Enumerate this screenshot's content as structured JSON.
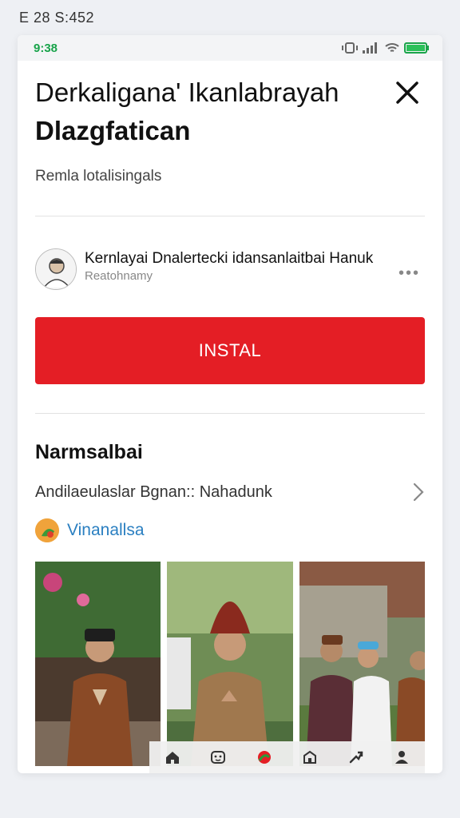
{
  "outer_status": {
    "text": "E 28 S:452"
  },
  "status_bar": {
    "time": "9:38"
  },
  "header": {
    "title_line1": "Derkaligana' Ikanlabrayah",
    "title_line2": "Dlazgfatican",
    "subtitle": "Remla lotalisingals"
  },
  "publisher": {
    "name": "Kernlayai Dnalertecki idansanlaitbai Hanuk",
    "sub": "Reatohnamy",
    "more_label": "•••"
  },
  "install": {
    "label": "INSTAL"
  },
  "section": {
    "title": "Narmsalbai",
    "row_text": "Andilaeulaslar Bgnan:: Nahadunk",
    "tag_label": "Vinanallsa"
  },
  "screenshots": [
    {
      "name": "screenshot-1"
    },
    {
      "name": "screenshot-2"
    },
    {
      "name": "screenshot-3"
    }
  ],
  "nav_icons": [
    "home-icon",
    "face-icon",
    "record-icon",
    "store-icon",
    "share-icon",
    "profile-icon"
  ],
  "colors": {
    "accent_red": "#e41e25",
    "link_blue": "#2a7fc1",
    "status_green": "#18a34a"
  }
}
